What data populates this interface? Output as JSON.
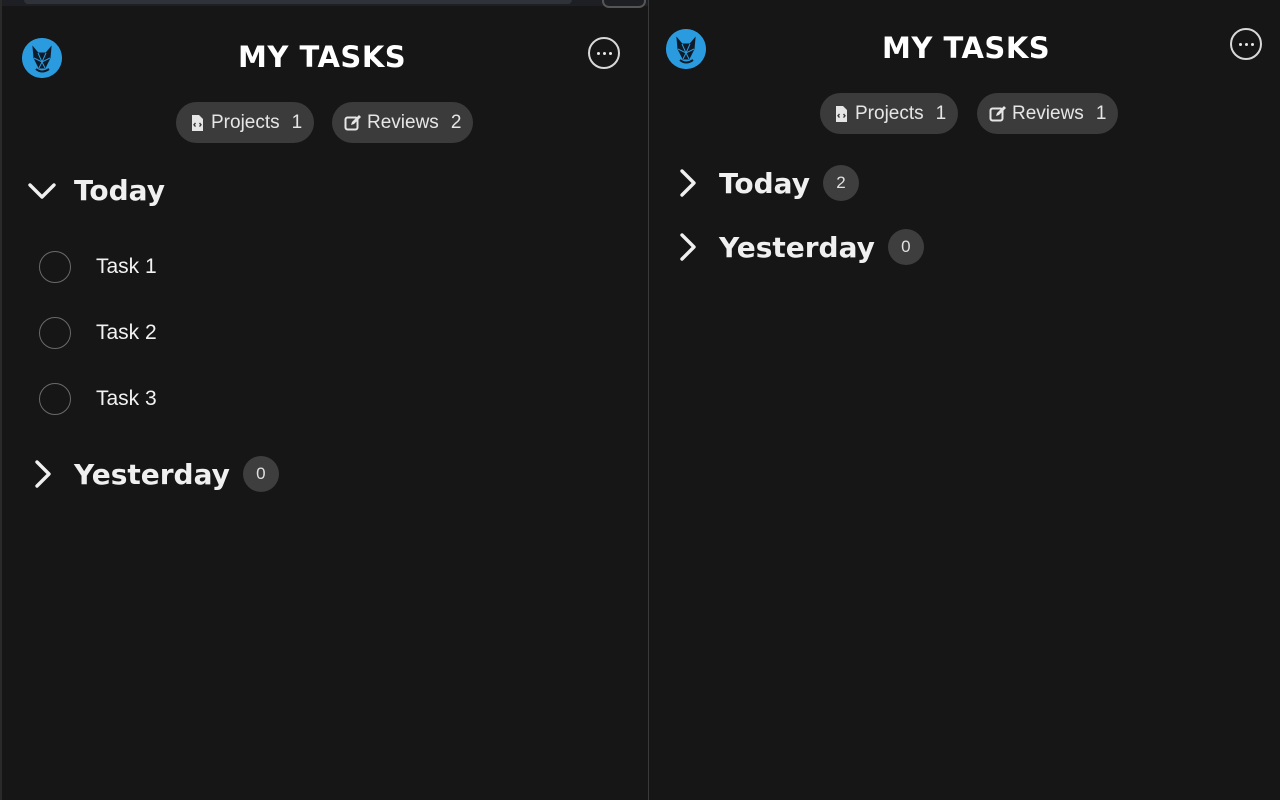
{
  "panels": {
    "left": {
      "title": "MY TASKS",
      "projects": {
        "label": "Projects",
        "count": "1",
        "icon": "file-code-icon"
      },
      "reviews": {
        "label": "Reviews",
        "count": "2",
        "icon": "edit-icon"
      },
      "sections": {
        "today": {
          "label": "Today",
          "expanded": true
        },
        "yesterday": {
          "label": "Yesterday",
          "count": "0",
          "expanded": false
        }
      },
      "tasks": [
        {
          "label": "Task 1",
          "done": false
        },
        {
          "label": "Task 2",
          "done": false
        },
        {
          "label": "Task 3",
          "done": false
        }
      ]
    },
    "right": {
      "title": "MY TASKS",
      "projects": {
        "label": "Projects",
        "count": "1",
        "icon": "file-code-icon"
      },
      "reviews": {
        "label": "Reviews",
        "count": "1",
        "icon": "edit-icon"
      },
      "sections": {
        "today": {
          "label": "Today",
          "count": "2",
          "expanded": false
        },
        "yesterday": {
          "label": "Yesterday",
          "count": "0",
          "expanded": false
        }
      }
    }
  },
  "colors": {
    "background": "#161616",
    "pill": "#3b3b3b",
    "badge": "#3e3e3e",
    "logo": "#2b9be0",
    "text": "#ffffff"
  }
}
